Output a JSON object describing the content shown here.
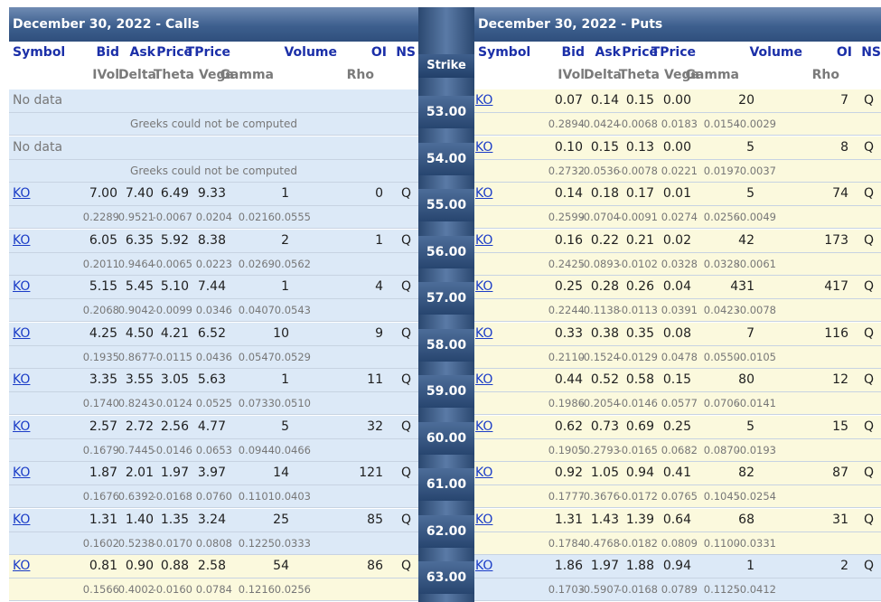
{
  "calls_title": "December 30, 2022 - Calls",
  "puts_title": "December 30, 2022 - Puts",
  "strike_label": "Strike",
  "headers_top": [
    "Symbol",
    "Bid",
    "Ask",
    "Price",
    "TPrice",
    "Volume",
    "OI",
    "NS"
  ],
  "headers_bottom": [
    "IVol",
    "Delta",
    "Theta",
    "Vega",
    "Gamma",
    "Rho"
  ],
  "no_data_text": "No data",
  "no_greeks_text": "Greeks could not be computed",
  "rows": [
    {
      "strike": "53.00",
      "call_nodata": true,
      "put": {
        "symbol": "KO",
        "bid": "0.07",
        "ask": "0.14",
        "price": "0.15",
        "tprice": "0.00",
        "volume": "20",
        "oi": "7",
        "ns": "Q",
        "ivol": "0.2894",
        "delta": "-0.0424",
        "theta": "-0.0068",
        "vega": "0.0183",
        "gamma": "0.0154",
        "rho": "-0.0029"
      }
    },
    {
      "strike": "54.00",
      "call_nodata": true,
      "put": {
        "symbol": "KO",
        "bid": "0.10",
        "ask": "0.15",
        "price": "0.13",
        "tprice": "0.00",
        "volume": "5",
        "oi": "8",
        "ns": "Q",
        "ivol": "0.2732",
        "delta": "-0.0536",
        "theta": "-0.0078",
        "vega": "0.0221",
        "gamma": "0.0197",
        "rho": "-0.0037"
      }
    },
    {
      "strike": "55.00",
      "call": {
        "symbol": "KO",
        "bid": "7.00",
        "ask": "7.40",
        "price": "6.49",
        "tprice": "9.33",
        "volume": "1",
        "oi": "0",
        "ns": "Q",
        "ivol": "0.2289",
        "delta": "0.9521",
        "theta": "-0.0067",
        "vega": "0.0204",
        "gamma": "0.0216",
        "rho": "0.0555"
      },
      "put": {
        "symbol": "KO",
        "bid": "0.14",
        "ask": "0.18",
        "price": "0.17",
        "tprice": "0.01",
        "volume": "5",
        "oi": "74",
        "ns": "Q",
        "ivol": "0.2599",
        "delta": "-0.0704",
        "theta": "-0.0091",
        "vega": "0.0274",
        "gamma": "0.0256",
        "rho": "-0.0049"
      }
    },
    {
      "strike": "56.00",
      "call": {
        "symbol": "KO",
        "bid": "6.05",
        "ask": "6.35",
        "price": "5.92",
        "tprice": "8.38",
        "volume": "2",
        "oi": "1",
        "ns": "Q",
        "ivol": "0.2011",
        "delta": "0.9464",
        "theta": "-0.0065",
        "vega": "0.0223",
        "gamma": "0.0269",
        "rho": "0.0562"
      },
      "put": {
        "symbol": "KO",
        "bid": "0.16",
        "ask": "0.22",
        "price": "0.21",
        "tprice": "0.02",
        "volume": "42",
        "oi": "173",
        "ns": "Q",
        "ivol": "0.2425",
        "delta": "-0.0893",
        "theta": "-0.0102",
        "vega": "0.0328",
        "gamma": "0.0328",
        "rho": "-0.0061"
      }
    },
    {
      "strike": "57.00",
      "call": {
        "symbol": "KO",
        "bid": "5.15",
        "ask": "5.45",
        "price": "5.10",
        "tprice": "7.44",
        "volume": "1",
        "oi": "4",
        "ns": "Q",
        "ivol": "0.2068",
        "delta": "0.9042",
        "theta": "-0.0099",
        "vega": "0.0346",
        "gamma": "0.0407",
        "rho": "0.0543"
      },
      "put": {
        "symbol": "KO",
        "bid": "0.25",
        "ask": "0.28",
        "price": "0.26",
        "tprice": "0.04",
        "volume": "431",
        "oi": "417",
        "ns": "Q",
        "ivol": "0.2244",
        "delta": "-0.1138",
        "theta": "-0.0113",
        "vega": "0.0391",
        "gamma": "0.0423",
        "rho": "-0.0078"
      }
    },
    {
      "strike": "58.00",
      "call": {
        "symbol": "KO",
        "bid": "4.25",
        "ask": "4.50",
        "price": "4.21",
        "tprice": "6.52",
        "volume": "10",
        "oi": "9",
        "ns": "Q",
        "ivol": "0.1935",
        "delta": "0.8677",
        "theta": "-0.0115",
        "vega": "0.0436",
        "gamma": "0.0547",
        "rho": "0.0529"
      },
      "put": {
        "symbol": "KO",
        "bid": "0.33",
        "ask": "0.38",
        "price": "0.35",
        "tprice": "0.08",
        "volume": "7",
        "oi": "116",
        "ns": "Q",
        "ivol": "0.2110",
        "delta": "-0.1524",
        "theta": "-0.0129",
        "vega": "0.0478",
        "gamma": "0.0550",
        "rho": "-0.0105"
      }
    },
    {
      "strike": "59.00",
      "call": {
        "symbol": "KO",
        "bid": "3.35",
        "ask": "3.55",
        "price": "3.05",
        "tprice": "5.63",
        "volume": "1",
        "oi": "11",
        "ns": "Q",
        "ivol": "0.1740",
        "delta": "0.8243",
        "theta": "-0.0124",
        "vega": "0.0525",
        "gamma": "0.0733",
        "rho": "0.0510"
      },
      "put": {
        "symbol": "KO",
        "bid": "0.44",
        "ask": "0.52",
        "price": "0.58",
        "tprice": "0.15",
        "volume": "80",
        "oi": "12",
        "ns": "Q",
        "ivol": "0.1986",
        "delta": "-0.2054",
        "theta": "-0.0146",
        "vega": "0.0577",
        "gamma": "0.0706",
        "rho": "-0.0141"
      }
    },
    {
      "strike": "60.00",
      "call": {
        "symbol": "KO",
        "bid": "2.57",
        "ask": "2.72",
        "price": "2.56",
        "tprice": "4.77",
        "volume": "5",
        "oi": "32",
        "ns": "Q",
        "ivol": "0.1679",
        "delta": "0.7445",
        "theta": "-0.0146",
        "vega": "0.0653",
        "gamma": "0.0944",
        "rho": "0.0466"
      },
      "put": {
        "symbol": "KO",
        "bid": "0.62",
        "ask": "0.73",
        "price": "0.69",
        "tprice": "0.25",
        "volume": "5",
        "oi": "15",
        "ns": "Q",
        "ivol": "0.1905",
        "delta": "-0.2793",
        "theta": "-0.0165",
        "vega": "0.0682",
        "gamma": "0.0870",
        "rho": "-0.0193"
      }
    },
    {
      "strike": "61.00",
      "call": {
        "symbol": "KO",
        "bid": "1.87",
        "ask": "2.01",
        "price": "1.97",
        "tprice": "3.97",
        "volume": "14",
        "oi": "121",
        "ns": "Q",
        "ivol": "0.1676",
        "delta": "0.6392",
        "theta": "-0.0168",
        "vega": "0.0760",
        "gamma": "0.1101",
        "rho": "0.0403"
      },
      "put": {
        "symbol": "KO",
        "bid": "0.92",
        "ask": "1.05",
        "price": "0.94",
        "tprice": "0.41",
        "volume": "82",
        "oi": "87",
        "ns": "Q",
        "ivol": "0.1777",
        "delta": "-0.3676",
        "theta": "-0.0172",
        "vega": "0.0765",
        "gamma": "0.1045",
        "rho": "-0.0254"
      }
    },
    {
      "strike": "62.00",
      "call": {
        "symbol": "KO",
        "bid": "1.31",
        "ask": "1.40",
        "price": "1.35",
        "tprice": "3.24",
        "volume": "25",
        "oi": "85",
        "ns": "Q",
        "ivol": "0.1602",
        "delta": "0.5238",
        "theta": "-0.0170",
        "vega": "0.0808",
        "gamma": "0.1225",
        "rho": "0.0333"
      },
      "put": {
        "symbol": "KO",
        "bid": "1.31",
        "ask": "1.43",
        "price": "1.39",
        "tprice": "0.64",
        "volume": "68",
        "oi": "31",
        "ns": "Q",
        "ivol": "0.1784",
        "delta": "-0.4768",
        "theta": "-0.0182",
        "vega": "0.0809",
        "gamma": "0.1100",
        "rho": "-0.0331"
      }
    },
    {
      "strike": "63.00",
      "call": {
        "symbol": "KO",
        "bid": "0.81",
        "ask": "0.90",
        "price": "0.88",
        "tprice": "2.58",
        "volume": "54",
        "oi": "86",
        "ns": "Q",
        "ivol": "0.1566",
        "delta": "0.4002",
        "theta": "-0.0160",
        "vega": "0.0784",
        "gamma": "0.1216",
        "rho": "0.0256"
      },
      "put": {
        "symbol": "KO",
        "bid": "1.86",
        "ask": "1.97",
        "price": "1.88",
        "tprice": "0.94",
        "volume": "1",
        "oi": "2",
        "ns": "Q",
        "ivol": "0.1703",
        "delta": "-0.5907",
        "theta": "-0.0168",
        "vega": "0.0789",
        "gamma": "0.1125",
        "rho": "-0.0412"
      }
    }
  ],
  "colors": {
    "itm": "#dce9f7",
    "otm": "#fbf9dd",
    "header_blue": "#1b2fa8",
    "link": "#1a3cc7"
  }
}
